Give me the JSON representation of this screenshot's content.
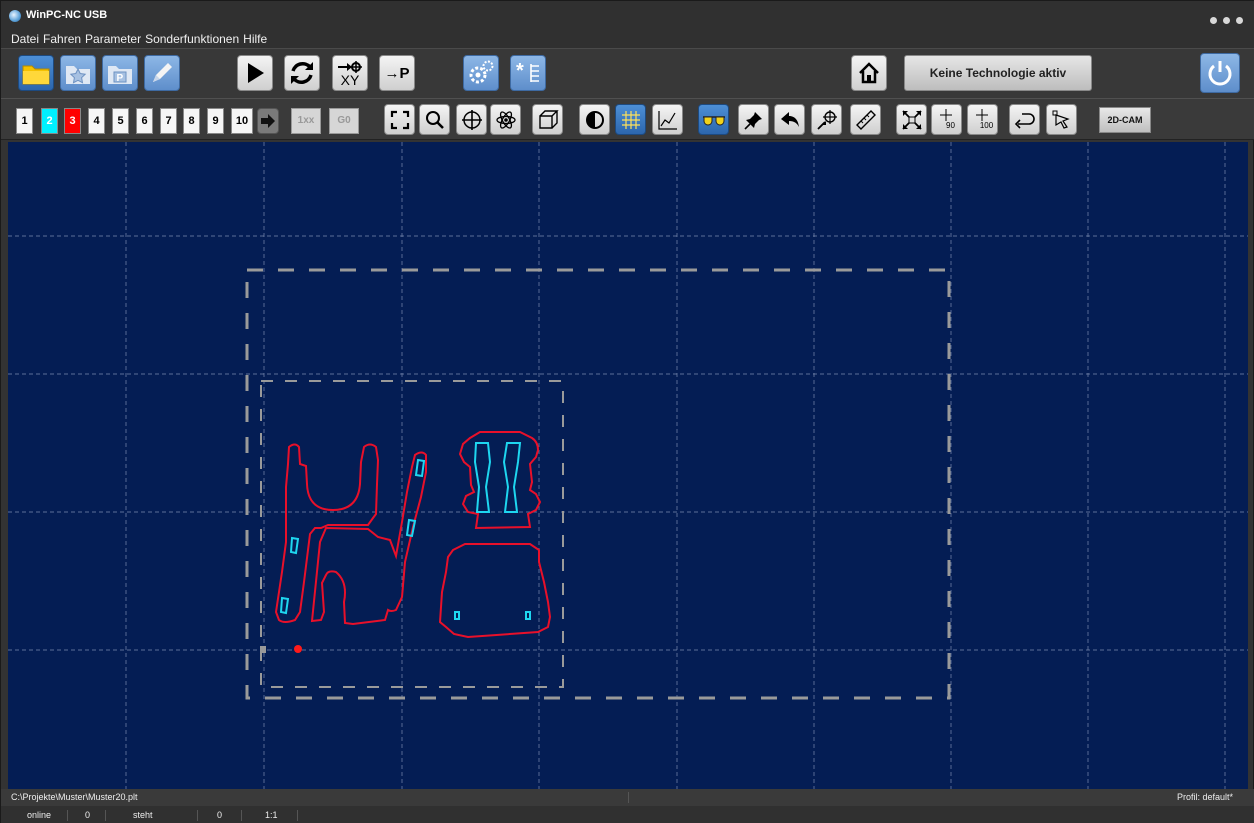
{
  "window": {
    "title": "WinPC-NC USB"
  },
  "menu": [
    "Datei",
    "Fahren",
    "Parameter",
    "Sonderfunktionen",
    "Hilfe"
  ],
  "toolbar": {
    "technology_label": "Keine Technologie aktiv",
    "cam_label": "2D-CAM",
    "goto_p_label": "→P",
    "xy_label": "XY",
    "repeat_label": "1xx",
    "g0_label": "G0",
    "rot90_label": "90",
    "rot100_label": "100"
  },
  "tools": [
    {
      "label": "1",
      "color": "#f6f6f6"
    },
    {
      "label": "2",
      "color": "#00f0ff"
    },
    {
      "label": "3",
      "color": "#ff0000"
    },
    {
      "label": "4",
      "color": "#f6f6f6"
    },
    {
      "label": "5",
      "color": "#f6f6f6"
    },
    {
      "label": "6",
      "color": "#f6f6f6"
    },
    {
      "label": "7",
      "color": "#f6f6f6"
    },
    {
      "label": "8",
      "color": "#f6f6f6"
    },
    {
      "label": "9",
      "color": "#f6f6f6"
    },
    {
      "label": "10",
      "color": "#f6f6f6"
    }
  ],
  "colors": {
    "canvas": "#041d54",
    "contour": "#e8102a",
    "pocket": "#1ed6f0",
    "frame": "#9a9a9a",
    "grid": "#7a8ab0"
  },
  "status": {
    "file_path": "C:\\Projekte\\Muster\\Muster20.plt",
    "profile": "Profil: default*",
    "connection": "online",
    "value1": "0",
    "machine_state": "steht",
    "value2": "0",
    "scale": "1:1"
  }
}
